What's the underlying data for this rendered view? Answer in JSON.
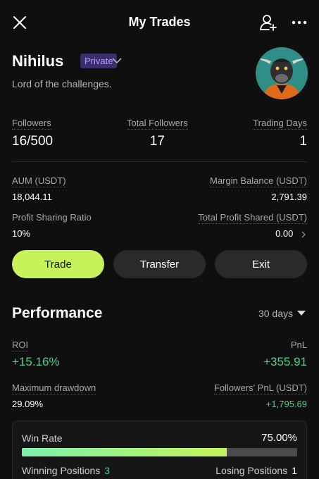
{
  "header": {
    "title": "My Trades"
  },
  "profile": {
    "name": "Nihilus",
    "badge": "Private",
    "bio": "Lord of the challenges."
  },
  "stats": {
    "followers_label": "Followers",
    "followers_value": "16/500",
    "total_followers_label": "Total Followers",
    "total_followers_value": "17",
    "trading_days_label": "Trading Days",
    "trading_days_value": "1"
  },
  "account": {
    "aum_label": "AUM (USDT)",
    "aum_value": "18,044.11",
    "margin_label": "Margin Balance (USDT)",
    "margin_value": "2,791.39",
    "psr_label": "Profit Sharing Ratio",
    "psr_value": "10%",
    "tps_label": "Total Profit Shared (USDT)",
    "tps_value": "0.00"
  },
  "actions": {
    "trade": "Trade",
    "transfer": "Transfer",
    "exit": "Exit"
  },
  "performance": {
    "title": "Performance",
    "range": "30 days",
    "roi_label": "ROI",
    "roi_value": "+15.16%",
    "pnl_label": "PnL",
    "pnl_value": "+355.91",
    "mdd_label": "Maximum drawdown",
    "mdd_value": "29.09%",
    "fpnl_label": "Followers' PnL (USDT)",
    "fpnl_value": "+1,795.69"
  },
  "winrate": {
    "label": "Win Rate",
    "value": "75.00%",
    "fraction": 0.75,
    "winning_label": "Winning Positions",
    "winning_count": "3",
    "losing_label": "Losing Positions",
    "losing_count": "1"
  },
  "colors": {
    "accent": "#c6f35a",
    "positive": "#4fcf8a",
    "badge_text": "#b49cff"
  },
  "icons": [
    "close-icon",
    "add-user-icon",
    "more-icon",
    "chevron-down-icon",
    "chevron-right-icon",
    "caret-down-icon"
  ]
}
